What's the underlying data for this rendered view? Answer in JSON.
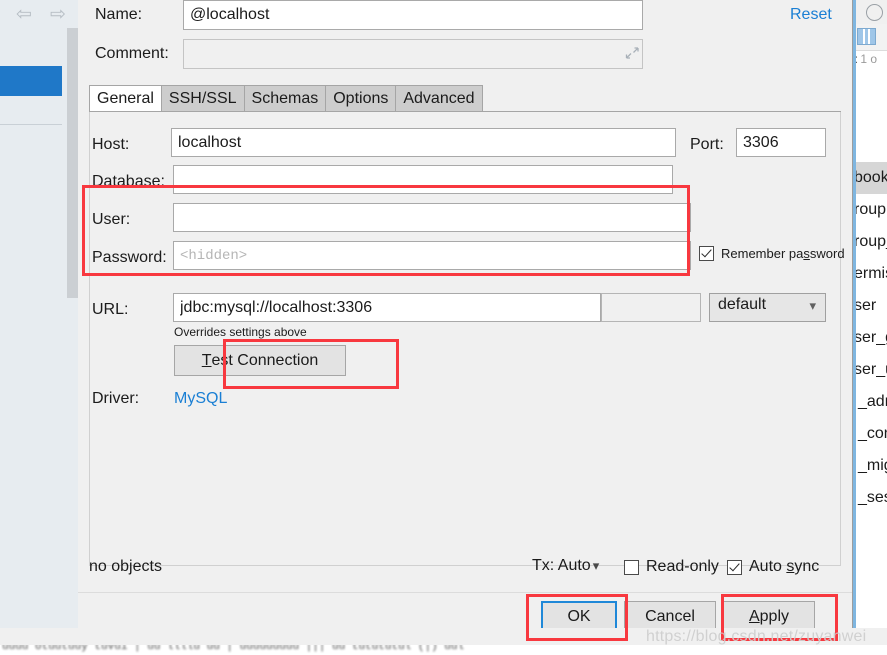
{
  "background": {
    "nav_back_icon": "arrow-left-icon",
    "nav_forward_icon": "arrow-right-icon",
    "right_panel": {
      "count_prefix": "t",
      "count_text": "1 o",
      "tree_items": [
        "book",
        "roup",
        "roup_",
        "ermis",
        "ser",
        "ser_g",
        "ser_u",
        "_adm",
        "_con",
        "_mig",
        "_sess"
      ]
    },
    "blurred_bottom_text": "uuuu otuutuuy tuvui | uu llllu uu | uuuuuuuuu ||| uu  tutututul (|) uul"
  },
  "dialog": {
    "name": {
      "label": "Name:",
      "value": "@localhost",
      "placeholder": ""
    },
    "comment": {
      "label": "Comment:",
      "value": "",
      "placeholder": "",
      "expand_icon": "expand-diagonal-icon"
    },
    "reset_link": "Reset",
    "tabs": [
      {
        "label": "General",
        "active": true
      },
      {
        "label": "SSH/SSL",
        "active": false
      },
      {
        "label": "Schemas",
        "active": false
      },
      {
        "label": "Options",
        "active": false
      },
      {
        "label": "Advanced",
        "active": false
      }
    ],
    "general": {
      "host": {
        "label": "Host:",
        "value": "localhost",
        "placeholder": ""
      },
      "port": {
        "label": "Port:",
        "value": "3306",
        "placeholder": ""
      },
      "database": {
        "label": "Database:",
        "value": "",
        "placeholder": ""
      },
      "user": {
        "label": "User:",
        "value": "",
        "placeholder": ""
      },
      "password": {
        "label": "Password:",
        "value": "",
        "placeholder": "<hidden>"
      },
      "remember_password": {
        "label_before": "Remember pa",
        "mnemonic": "s",
        "label_after": "sword",
        "checked": true
      },
      "url": {
        "label": "URL:",
        "value": "jdbc:mysql://localhost:3306",
        "placeholder": ""
      },
      "url_extra": {
        "value": "",
        "placeholder": ""
      },
      "url_mode": {
        "selected": "default",
        "chevron_icon": "chevron-down-icon"
      },
      "overrides_note": "Overrides settings above",
      "test_connection": {
        "mnemonic": "T",
        "label_after": "est Connection"
      },
      "driver": {
        "label": "Driver:",
        "value": "MySQL"
      }
    },
    "status": {
      "no_objects": "no objects",
      "tx_label": "Tx: Auto",
      "tx_chevron_icon": "chevron-down-icon",
      "read_only": {
        "label": "Read-only",
        "checked": false
      },
      "auto_sync": {
        "label_before": "Auto ",
        "mnemonic": "s",
        "label_after": "ync",
        "checked": true
      }
    },
    "footer": {
      "ok": "OK",
      "cancel": "Cancel",
      "apply_mnemonic": "A",
      "apply_after": "pply"
    }
  },
  "watermark": "https://blog.csdn.net/zuyanwei",
  "colors": {
    "accent_blue": "#1a7fd4",
    "focus_blue": "#1f88d8",
    "annotation_red": "#f8383f",
    "selection_blue": "#1f78c8",
    "dialog_bg": "#f0f0f0"
  }
}
